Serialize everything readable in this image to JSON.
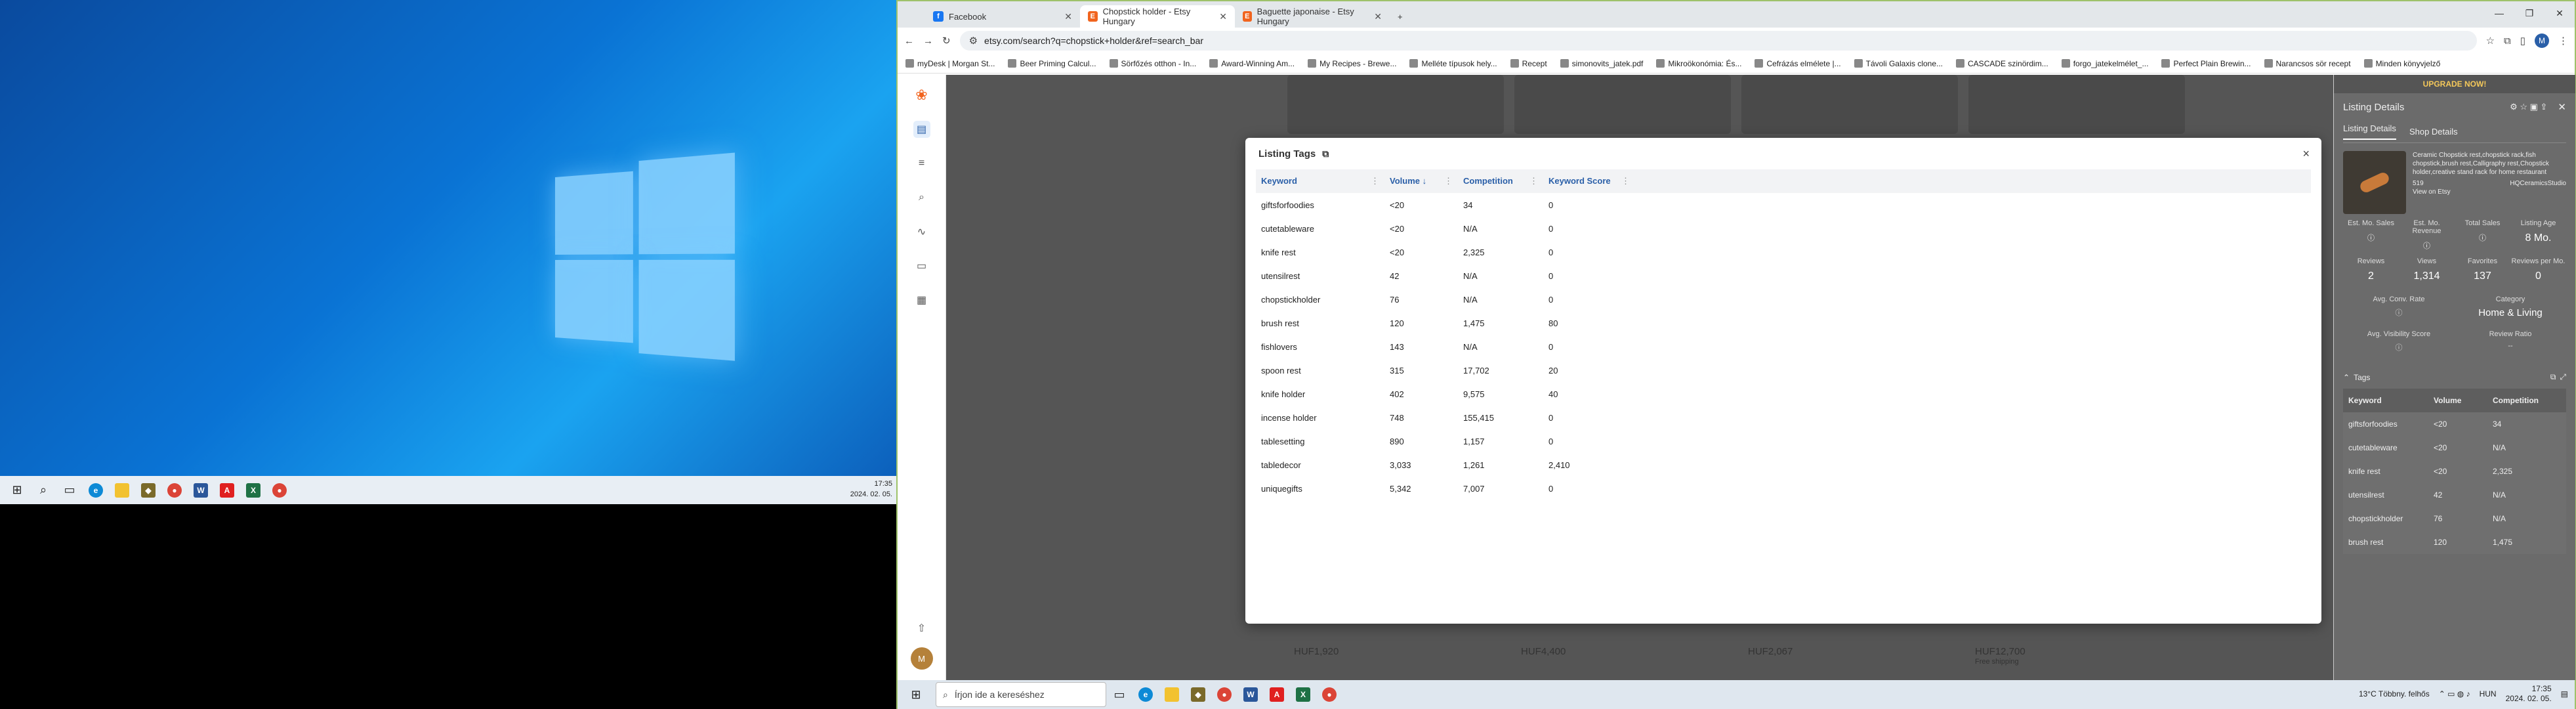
{
  "left_screen": {
    "clock_time": "17:35",
    "clock_date": "2024. 02. 05."
  },
  "browser": {
    "tabs": [
      {
        "title": "Facebook",
        "icon": "facebook-icon",
        "color": "#1877f2",
        "letter": "f"
      },
      {
        "title": "Chopstick holder - Etsy Hungary",
        "icon": "etsy-icon",
        "color": "#f1641e",
        "letter": "E"
      },
      {
        "title": "Baguette japonaise - Etsy Hungary",
        "icon": "etsy-icon",
        "color": "#f1641e",
        "letter": "E"
      }
    ],
    "url": "etsy.com/search?q=chopstick+holder&ref=search_bar",
    "bookmarks": [
      "myDesk | Morgan St...",
      "Beer Priming Calcul...",
      "Sörfőzés otthon - In...",
      "Award-Winning Am...",
      "My Recipes - Brewe...",
      "Melléte típusok hely...",
      "Recept",
      "simonovits_jatek.pdf",
      "Mikroökonómia: És...",
      "Cefrázás elmélete |...",
      "Távoli Galaxis clone...",
      "CASCADE szinördim...",
      "forgo_jatekelmélet_...",
      "Perfect Plain Brewin...",
      "Narancsos sör recept",
      "Minden könyvjelző"
    ]
  },
  "modal": {
    "title": "Listing Tags",
    "close_label": "×",
    "columns": [
      "Keyword",
      "Volume",
      "Competition",
      "Keyword Score"
    ],
    "rows": [
      [
        "giftsforfoodies",
        "<20",
        "34",
        "0"
      ],
      [
        "cutetableware",
        "<20",
        "N/A",
        "0"
      ],
      [
        "knife rest",
        "<20",
        "2,325",
        "0"
      ],
      [
        "utensilrest",
        "42",
        "N/A",
        "0"
      ],
      [
        "chopstickholder",
        "76",
        "N/A",
        "0"
      ],
      [
        "brush rest",
        "120",
        "1,475",
        "80"
      ],
      [
        "fishlovers",
        "143",
        "N/A",
        "0"
      ],
      [
        "spoon rest",
        "315",
        "17,702",
        "20"
      ],
      [
        "knife holder",
        "402",
        "9,575",
        "40"
      ],
      [
        "incense holder",
        "748",
        "155,415",
        "0"
      ],
      [
        "tablesetting",
        "890",
        "1,157",
        "0"
      ],
      [
        "tabledecor",
        "3,033",
        "1,261",
        "2,410"
      ],
      [
        "uniquegifts",
        "5,342",
        "7,007",
        "0"
      ]
    ]
  },
  "background_listings": {
    "prices": [
      "HUF1,920",
      "HUF4,400",
      "HUF2,067",
      "HUF12,700"
    ],
    "free_shipping": "Free shipping"
  },
  "panel": {
    "upgrade": "UPGRADE NOW!",
    "title": "Listing Details",
    "tabs": [
      "Listing Details",
      "Shop Details"
    ],
    "listing_title": "Ceramic Chopstick rest,chopstick rack,fish chopstick,brush rest,Calligraphy rest,Chopstick holder,creative stand rack for home restaurant",
    "price": "519",
    "shop": "HQCeramicsStudio",
    "view_on_etsy": "View on Etsy",
    "metrics": [
      {
        "label": "Est. Mo. Sales",
        "value": ""
      },
      {
        "label": "Est. Mo. Revenue",
        "value": ""
      },
      {
        "label": "Total Sales",
        "value": ""
      },
      {
        "label": "Listing Age",
        "value": "8 Mo."
      },
      {
        "label": "Reviews",
        "value": "2"
      },
      {
        "label": "Views",
        "value": "1,314"
      },
      {
        "label": "Favorites",
        "value": "137"
      },
      {
        "label": "Reviews per Mo.",
        "value": "0"
      }
    ],
    "conv_rate_label": "Avg. Conv. Rate",
    "category_label": "Category",
    "category_value": "Home & Living",
    "visibility_label": "Avg. Visibility Score",
    "review_ratio_label": "Review Ratio",
    "review_ratio_value": "--",
    "tags_label": "Tags",
    "tag_columns": [
      "Keyword",
      "Volume",
      "Competition"
    ],
    "tag_rows": [
      [
        "giftsforfoodies",
        "<20",
        "34"
      ],
      [
        "cutetableware",
        "<20",
        "N/A"
      ],
      [
        "knife rest",
        "<20",
        "2,325"
      ],
      [
        "utensilrest",
        "42",
        "N/A"
      ],
      [
        "chopstickholder",
        "76",
        "N/A"
      ],
      [
        "brush rest",
        "120",
        "1,475"
      ]
    ]
  },
  "taskbar": {
    "search_placeholder": "Írjon ide a kereséshez",
    "weather": "13°C Többny. felhős",
    "lang": "HUN",
    "time": "17:35",
    "date": "2024. 02. 05."
  },
  "avatar_letter": "M"
}
